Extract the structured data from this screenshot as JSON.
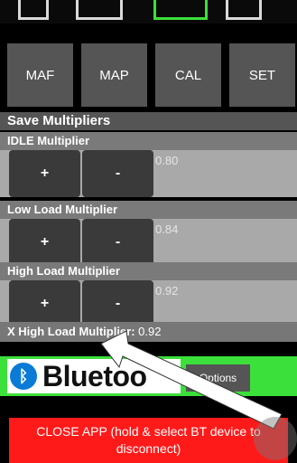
{
  "tabs": [
    {
      "label": "MAF"
    },
    {
      "label": "MAP"
    },
    {
      "label": "CAL"
    },
    {
      "label": "SET"
    }
  ],
  "save_title": "Save Multipliers",
  "idle": {
    "label": "IDLE Multiplier",
    "plus": "+",
    "minus": "-",
    "value": "0.80"
  },
  "low": {
    "label": "Low Load Multiplier",
    "plus": "+",
    "minus": "-",
    "value": "0.84"
  },
  "high": {
    "label": "High Load Multiplier",
    "plus": "+",
    "minus": "-",
    "value": "0.92"
  },
  "xhigh": {
    "label": "X High Load Multiplier:",
    "value": "0.92"
  },
  "bluetooth": {
    "text": "Bluetoo",
    "icon": "bluetooth-icon"
  },
  "options_label": "Options",
  "close_label": "CLOSE APP (hold & select BT device to disconnect)",
  "colors": {
    "green": "#3be03b",
    "red": "#ff1a1a",
    "bt_blue": "#0a7bd6"
  }
}
